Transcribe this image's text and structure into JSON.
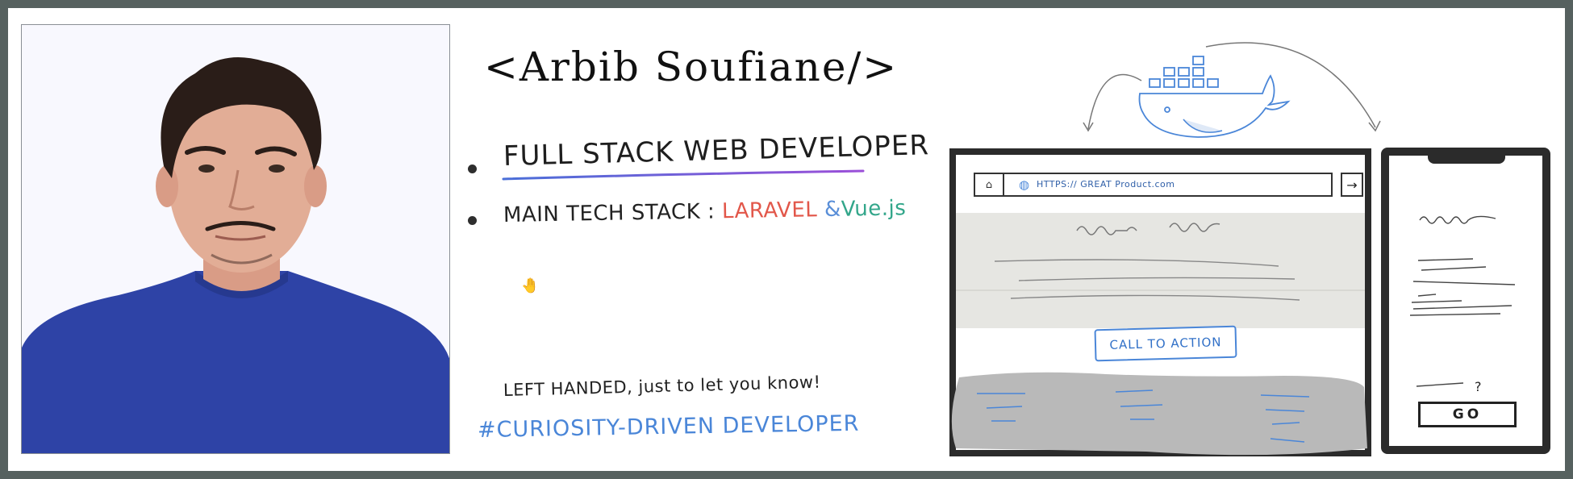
{
  "profile": {
    "name": "<Arbib Soufiane/>",
    "title": "FULL STACK WEB DEVELOPER",
    "stack_label": "MAIN TECH STACK :",
    "stack_laravel": "LARAVEL",
    "stack_amp": "&",
    "stack_vue": "Vue.js",
    "hand_emoji": "🤚",
    "left_handed": "LEFT HANDED, just to let you know!",
    "hashtag": "#CURIOSITY-DRIVEN DEVELOPER"
  },
  "mockup": {
    "url": "HTTPS:// GREAT Product.com",
    "cta": "CALL TO ACTION",
    "go_label": "GO",
    "question_mark": "?"
  },
  "colors": {
    "frame": "#56615f",
    "laravel": "#e2574a",
    "vue": "#32a68a",
    "sketch_blue": "#4a86d8",
    "underline_gradient": [
      "#4a6fd8",
      "#9b4fd8"
    ]
  },
  "icons": [
    "avatar-photo",
    "hand-icon",
    "docker-whale-icon",
    "home-icon",
    "globe-icon",
    "arrow-right-icon"
  ]
}
